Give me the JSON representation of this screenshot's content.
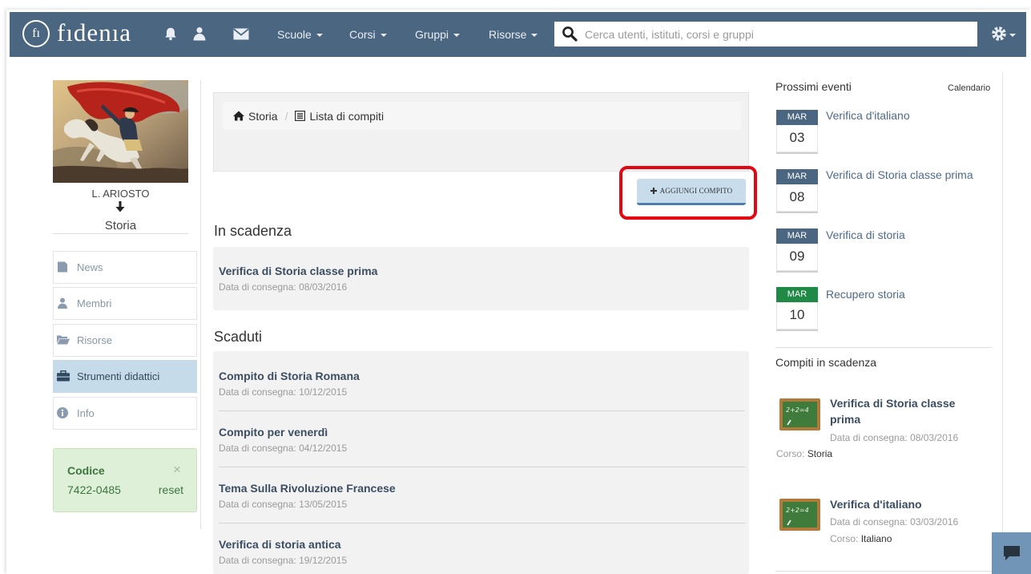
{
  "app": {
    "logo_mark": "fı",
    "logo_text": "fıdenıa"
  },
  "navbar": {
    "menus": [
      {
        "label": "Scuole"
      },
      {
        "label": "Corsi"
      },
      {
        "label": "Gruppi"
      },
      {
        "label": "Risorse"
      }
    ],
    "search_placeholder": "Cerca utenti, istituti, corsi e gruppi",
    "icons": {
      "notifications": "bell-icon",
      "profile": "user-icon",
      "messages": "envelope-icon",
      "search": "search-icon",
      "settings": "gear-icon"
    }
  },
  "course": {
    "teacher": "L. ARIOSTO",
    "name": "Storia"
  },
  "sidebar": {
    "items": [
      {
        "label": "News",
        "icon": "news-icon",
        "active": false
      },
      {
        "label": "Membri",
        "icon": "user-icon",
        "active": false
      },
      {
        "label": "Risorse",
        "icon": "folder-icon",
        "active": false
      },
      {
        "label": "Strumenti didattici",
        "icon": "briefcase-icon",
        "active": true
      },
      {
        "label": "Info",
        "icon": "info-icon",
        "active": false
      }
    ]
  },
  "code_box": {
    "title": "Codice",
    "close": "×",
    "code": "7422-0485",
    "reset": "reset"
  },
  "breadcrumb": {
    "home": "Storia",
    "separator": "/",
    "current": "Lista di compiti"
  },
  "add_button": {
    "label": "AGGIUNGI COMPITO",
    "icon": "plus-icon"
  },
  "assignments": {
    "due": {
      "heading": "In scadenza",
      "items": [
        {
          "title": "Verifica di Storia classe prima",
          "date": "Data di consegna: 08/03/2016"
        }
      ]
    },
    "expired": {
      "heading": "Scaduti",
      "items": [
        {
          "title": "Compito di Storia Romana",
          "date": "Data di consegna: 10/12/2015"
        },
        {
          "title": "Compito per venerdì",
          "date": "Data di consegna: 04/12/2015"
        },
        {
          "title": "Tema Sulla Rivoluzione Francese",
          "date": "Data di consegna: 13/05/2015"
        },
        {
          "title": "Verifica di storia antica",
          "date": "Data di consegna: 19/12/2015"
        }
      ]
    }
  },
  "events": {
    "heading": "Prossimi eventi",
    "calendar_link": "Calendario",
    "items": [
      {
        "month": "MAR",
        "day": "03",
        "title": "Verifica d'italiano",
        "color": "#4b6681"
      },
      {
        "month": "MAR",
        "day": "08",
        "title": "Verifica di Storia classe prima",
        "color": "#4b6681"
      },
      {
        "month": "MAR",
        "day": "09",
        "title": "Verifica di storia",
        "color": "#4b6681"
      },
      {
        "month": "MAR",
        "day": "10",
        "title": "Recupero storia",
        "color": "#1f8a46"
      }
    ]
  },
  "upcoming_tasks": {
    "heading": "Compiti in scadenza",
    "items": [
      {
        "title": "Verifica di Storia classe prima",
        "date": "Data di consegna: 08/03/2016",
        "course_label": "Corso:",
        "course": "Storia",
        "chalk_text": "2+2=4",
        "icon": "chalkboard-icon"
      },
      {
        "title": "Verifica d'italiano",
        "date": "Data di consegna: 03/03/2016",
        "course_label": "Corso:",
        "course": "Italiano",
        "chalk_text": "2+2=4",
        "icon": "chalkboard-icon"
      }
    ]
  },
  "chat": {
    "icon": "chat-icon"
  },
  "colors": {
    "navbar": "#4b6681",
    "active_nav": "#c6dbea",
    "code_box": "#dff0d8",
    "add_button": "#c8dcec",
    "highlight": "#e30613",
    "event_green": "#1f8a46"
  }
}
